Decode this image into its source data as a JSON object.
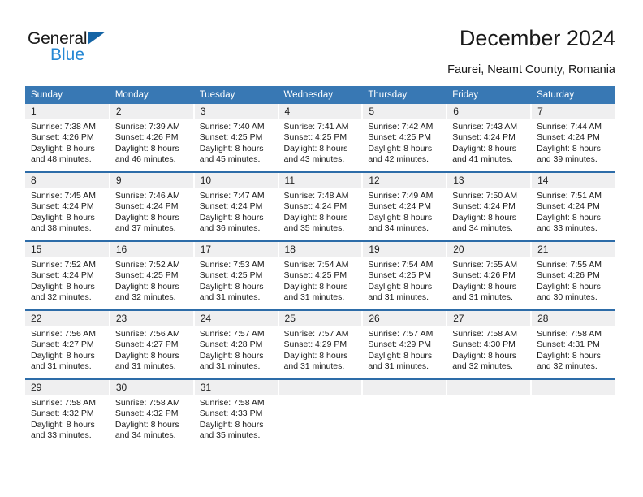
{
  "brand": {
    "name_top": "General",
    "name_bottom": "Blue",
    "triangle_color": "#1464a5",
    "blue_color": "#2688d4"
  },
  "header": {
    "title": "December 2024",
    "subtitle": "Faurei, Neamt County, Romania"
  },
  "theme": {
    "header_bg": "#3878b4",
    "daynum_bg": "#efeff0",
    "separator": "#2d6ca8",
    "text": "#1a1a1a"
  },
  "weekdays": [
    "Sunday",
    "Monday",
    "Tuesday",
    "Wednesday",
    "Thursday",
    "Friday",
    "Saturday"
  ],
  "weeks": [
    {
      "days": [
        {
          "num": "1",
          "sunrise": "Sunrise: 7:38 AM",
          "sunset": "Sunset: 4:26 PM",
          "daylight1": "Daylight: 8 hours",
          "daylight2": "and 48 minutes."
        },
        {
          "num": "2",
          "sunrise": "Sunrise: 7:39 AM",
          "sunset": "Sunset: 4:26 PM",
          "daylight1": "Daylight: 8 hours",
          "daylight2": "and 46 minutes."
        },
        {
          "num": "3",
          "sunrise": "Sunrise: 7:40 AM",
          "sunset": "Sunset: 4:25 PM",
          "daylight1": "Daylight: 8 hours",
          "daylight2": "and 45 minutes."
        },
        {
          "num": "4",
          "sunrise": "Sunrise: 7:41 AM",
          "sunset": "Sunset: 4:25 PM",
          "daylight1": "Daylight: 8 hours",
          "daylight2": "and 43 minutes."
        },
        {
          "num": "5",
          "sunrise": "Sunrise: 7:42 AM",
          "sunset": "Sunset: 4:25 PM",
          "daylight1": "Daylight: 8 hours",
          "daylight2": "and 42 minutes."
        },
        {
          "num": "6",
          "sunrise": "Sunrise: 7:43 AM",
          "sunset": "Sunset: 4:24 PM",
          "daylight1": "Daylight: 8 hours",
          "daylight2": "and 41 minutes."
        },
        {
          "num": "7",
          "sunrise": "Sunrise: 7:44 AM",
          "sunset": "Sunset: 4:24 PM",
          "daylight1": "Daylight: 8 hours",
          "daylight2": "and 39 minutes."
        }
      ]
    },
    {
      "days": [
        {
          "num": "8",
          "sunrise": "Sunrise: 7:45 AM",
          "sunset": "Sunset: 4:24 PM",
          "daylight1": "Daylight: 8 hours",
          "daylight2": "and 38 minutes."
        },
        {
          "num": "9",
          "sunrise": "Sunrise: 7:46 AM",
          "sunset": "Sunset: 4:24 PM",
          "daylight1": "Daylight: 8 hours",
          "daylight2": "and 37 minutes."
        },
        {
          "num": "10",
          "sunrise": "Sunrise: 7:47 AM",
          "sunset": "Sunset: 4:24 PM",
          "daylight1": "Daylight: 8 hours",
          "daylight2": "and 36 minutes."
        },
        {
          "num": "11",
          "sunrise": "Sunrise: 7:48 AM",
          "sunset": "Sunset: 4:24 PM",
          "daylight1": "Daylight: 8 hours",
          "daylight2": "and 35 minutes."
        },
        {
          "num": "12",
          "sunrise": "Sunrise: 7:49 AM",
          "sunset": "Sunset: 4:24 PM",
          "daylight1": "Daylight: 8 hours",
          "daylight2": "and 34 minutes."
        },
        {
          "num": "13",
          "sunrise": "Sunrise: 7:50 AM",
          "sunset": "Sunset: 4:24 PM",
          "daylight1": "Daylight: 8 hours",
          "daylight2": "and 34 minutes."
        },
        {
          "num": "14",
          "sunrise": "Sunrise: 7:51 AM",
          "sunset": "Sunset: 4:24 PM",
          "daylight1": "Daylight: 8 hours",
          "daylight2": "and 33 minutes."
        }
      ]
    },
    {
      "days": [
        {
          "num": "15",
          "sunrise": "Sunrise: 7:52 AM",
          "sunset": "Sunset: 4:24 PM",
          "daylight1": "Daylight: 8 hours",
          "daylight2": "and 32 minutes."
        },
        {
          "num": "16",
          "sunrise": "Sunrise: 7:52 AM",
          "sunset": "Sunset: 4:25 PM",
          "daylight1": "Daylight: 8 hours",
          "daylight2": "and 32 minutes."
        },
        {
          "num": "17",
          "sunrise": "Sunrise: 7:53 AM",
          "sunset": "Sunset: 4:25 PM",
          "daylight1": "Daylight: 8 hours",
          "daylight2": "and 31 minutes."
        },
        {
          "num": "18",
          "sunrise": "Sunrise: 7:54 AM",
          "sunset": "Sunset: 4:25 PM",
          "daylight1": "Daylight: 8 hours",
          "daylight2": "and 31 minutes."
        },
        {
          "num": "19",
          "sunrise": "Sunrise: 7:54 AM",
          "sunset": "Sunset: 4:25 PM",
          "daylight1": "Daylight: 8 hours",
          "daylight2": "and 31 minutes."
        },
        {
          "num": "20",
          "sunrise": "Sunrise: 7:55 AM",
          "sunset": "Sunset: 4:26 PM",
          "daylight1": "Daylight: 8 hours",
          "daylight2": "and 31 minutes."
        },
        {
          "num": "21",
          "sunrise": "Sunrise: 7:55 AM",
          "sunset": "Sunset: 4:26 PM",
          "daylight1": "Daylight: 8 hours",
          "daylight2": "and 30 minutes."
        }
      ]
    },
    {
      "days": [
        {
          "num": "22",
          "sunrise": "Sunrise: 7:56 AM",
          "sunset": "Sunset: 4:27 PM",
          "daylight1": "Daylight: 8 hours",
          "daylight2": "and 31 minutes."
        },
        {
          "num": "23",
          "sunrise": "Sunrise: 7:56 AM",
          "sunset": "Sunset: 4:27 PM",
          "daylight1": "Daylight: 8 hours",
          "daylight2": "and 31 minutes."
        },
        {
          "num": "24",
          "sunrise": "Sunrise: 7:57 AM",
          "sunset": "Sunset: 4:28 PM",
          "daylight1": "Daylight: 8 hours",
          "daylight2": "and 31 minutes."
        },
        {
          "num": "25",
          "sunrise": "Sunrise: 7:57 AM",
          "sunset": "Sunset: 4:29 PM",
          "daylight1": "Daylight: 8 hours",
          "daylight2": "and 31 minutes."
        },
        {
          "num": "26",
          "sunrise": "Sunrise: 7:57 AM",
          "sunset": "Sunset: 4:29 PM",
          "daylight1": "Daylight: 8 hours",
          "daylight2": "and 31 minutes."
        },
        {
          "num": "27",
          "sunrise": "Sunrise: 7:58 AM",
          "sunset": "Sunset: 4:30 PM",
          "daylight1": "Daylight: 8 hours",
          "daylight2": "and 32 minutes."
        },
        {
          "num": "28",
          "sunrise": "Sunrise: 7:58 AM",
          "sunset": "Sunset: 4:31 PM",
          "daylight1": "Daylight: 8 hours",
          "daylight2": "and 32 minutes."
        }
      ]
    },
    {
      "days": [
        {
          "num": "29",
          "sunrise": "Sunrise: 7:58 AM",
          "sunset": "Sunset: 4:32 PM",
          "daylight1": "Daylight: 8 hours",
          "daylight2": "and 33 minutes."
        },
        {
          "num": "30",
          "sunrise": "Sunrise: 7:58 AM",
          "sunset": "Sunset: 4:32 PM",
          "daylight1": "Daylight: 8 hours",
          "daylight2": "and 34 minutes."
        },
        {
          "num": "31",
          "sunrise": "Sunrise: 7:58 AM",
          "sunset": "Sunset: 4:33 PM",
          "daylight1": "Daylight: 8 hours",
          "daylight2": "and 35 minutes."
        },
        {
          "num": "",
          "sunrise": "",
          "sunset": "",
          "daylight1": "",
          "daylight2": ""
        },
        {
          "num": "",
          "sunrise": "",
          "sunset": "",
          "daylight1": "",
          "daylight2": ""
        },
        {
          "num": "",
          "sunrise": "",
          "sunset": "",
          "daylight1": "",
          "daylight2": ""
        },
        {
          "num": "",
          "sunrise": "",
          "sunset": "",
          "daylight1": "",
          "daylight2": ""
        }
      ]
    }
  ]
}
